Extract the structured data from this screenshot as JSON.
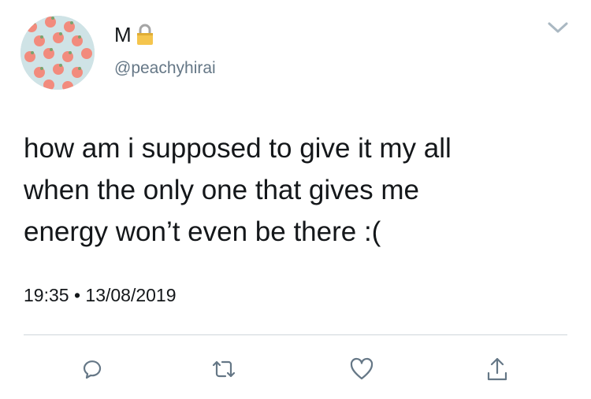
{
  "tweet": {
    "display_name": "M",
    "handle": "@peachyhirai",
    "text": "how am i supposed to give it my all\nwhen the only one that gives me\nenergy won’t even be there :(",
    "time": "19:35",
    "separator": "•",
    "date": "13/08/2019"
  },
  "icons": {
    "lock": "lock-icon",
    "chevron": "chevron-down-icon",
    "reply": "reply-icon",
    "retweet": "retweet-icon",
    "like": "heart-icon",
    "share": "share-icon"
  },
  "colors": {
    "text": "#14171a",
    "secondary": "#657786",
    "avatar_bg": "#cfe3e6",
    "peach": "#f28b7d",
    "lock": "#f5c54d"
  }
}
